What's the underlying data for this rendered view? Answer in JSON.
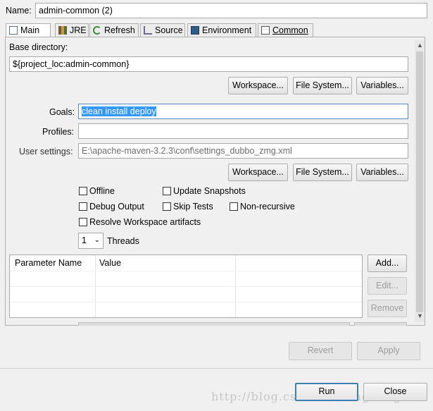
{
  "name": {
    "label": "Name:",
    "value": "admin-common (2)"
  },
  "tabs": [
    {
      "label": "Main",
      "icon": "document-icon"
    },
    {
      "label": "JRE",
      "icon": "library-icon"
    },
    {
      "label": "Refresh",
      "icon": "refresh-icon"
    },
    {
      "label": "Source",
      "icon": "source-icon"
    },
    {
      "label": "Environment",
      "icon": "environment-icon"
    },
    {
      "label": "Common",
      "icon": "common-icon"
    }
  ],
  "base_directory": {
    "label": "Base directory:",
    "value": "${project_loc:admin-common}"
  },
  "buttons_row1": {
    "workspace": "Workspace...",
    "file_system": "File System...",
    "variables": "Variables..."
  },
  "goals": {
    "label": "Goals:",
    "value": "clean install deploy"
  },
  "profiles": {
    "label": "Profiles:",
    "value": ""
  },
  "user_settings": {
    "label": "User settings:",
    "value": "E:\\apache-maven-3.2.3\\conf\\settings_dubbo_zmg.xml"
  },
  "buttons_row2": {
    "workspace": "Workspace...",
    "file_system": "File System...",
    "variables": "Variables..."
  },
  "options": {
    "offline": "Offline",
    "update_snapshots": "Update Snapshots",
    "debug_output": "Debug Output",
    "skip_tests": "Skip Tests",
    "non_recursive": "Non-recursive",
    "resolve_workspace": "Resolve Workspace artifacts"
  },
  "threads": {
    "value": "1",
    "label": "Threads"
  },
  "params_table": {
    "columns": [
      "Parameter Name",
      "Value"
    ]
  },
  "param_buttons": {
    "add": "Add...",
    "edit": "Edit...",
    "remove": "Remove"
  },
  "footer": {
    "revert": "Revert",
    "apply": "Apply",
    "run": "Run",
    "close": "Close"
  },
  "watermark": "http://blog.csdn.net/fengmingen"
}
